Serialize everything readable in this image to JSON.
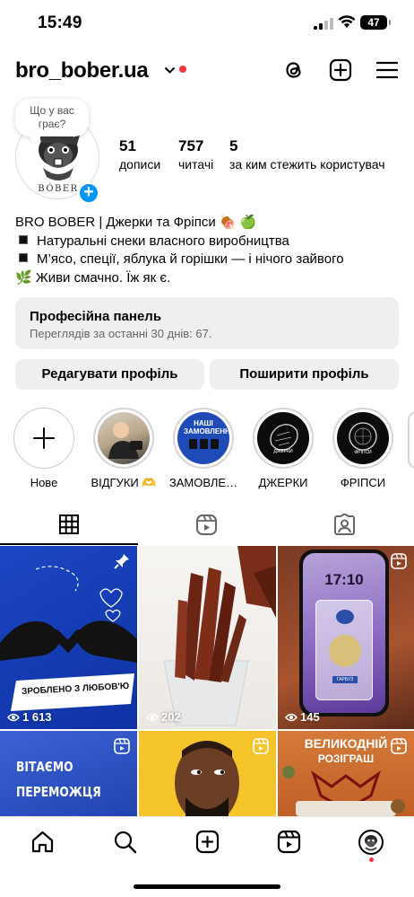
{
  "status_bar": {
    "time": "15:49",
    "battery": "47"
  },
  "header": {
    "username": "bro_bober.ua"
  },
  "profile": {
    "note": "Що у вас грає?",
    "avatar_text": "BÓBER",
    "stats": [
      {
        "num": "51",
        "label": "дописи"
      },
      {
        "num": "757",
        "label": "читачі"
      },
      {
        "num": "5",
        "label": "за ким стежить користувач"
      }
    ],
    "bio": {
      "line1": "BRO BOBER | Джерки та Фріпси 🍖 🍏",
      "line2": "Натуральні снеки власного виробництва",
      "line3": "М’ясо, спеції, яблука й горішки — і нічого зайвого",
      "line4": "🌿 Живи смачно. Їж як є."
    }
  },
  "panel": {
    "title": "Професійна панель",
    "subtitle": "Переглядів за останні 30 днів: 67."
  },
  "buttons": {
    "edit": "Редагувати профіль",
    "share": "Поширити профіль"
  },
  "highlights": [
    {
      "label": "Нове",
      "inner": ""
    },
    {
      "label": "ВІДГУКИ 🫶",
      "inner": ""
    },
    {
      "label": "ЗАМОВЛЕ…",
      "inner": "НАШІ ЗАМОВЛЕННЯ"
    },
    {
      "label": "ДЖЕРКИ",
      "inner": "ДЖЕРКИ"
    },
    {
      "label": "ФРІПСИ",
      "inner": "ФРІПСИ"
    }
  ],
  "grid": [
    {
      "views": "1 613",
      "caption": "ЗРОБЛЕНО З ЛЮБОВ'Ю"
    },
    {
      "views": "202"
    },
    {
      "views": "145",
      "phone_time": "17:10",
      "pack_label": "ГАРБУЗ"
    },
    {
      "caption": "ВІТАЄМО ПЕРЕМОЖЦЯ"
    },
    {},
    {
      "caption1": "ВЕЛИКОДНІЙ",
      "caption2": "РОЗІГРАШ"
    }
  ],
  "colors": {
    "accent": "#0095f6",
    "notif": "#ff3040",
    "panel_bg": "#efefef"
  }
}
